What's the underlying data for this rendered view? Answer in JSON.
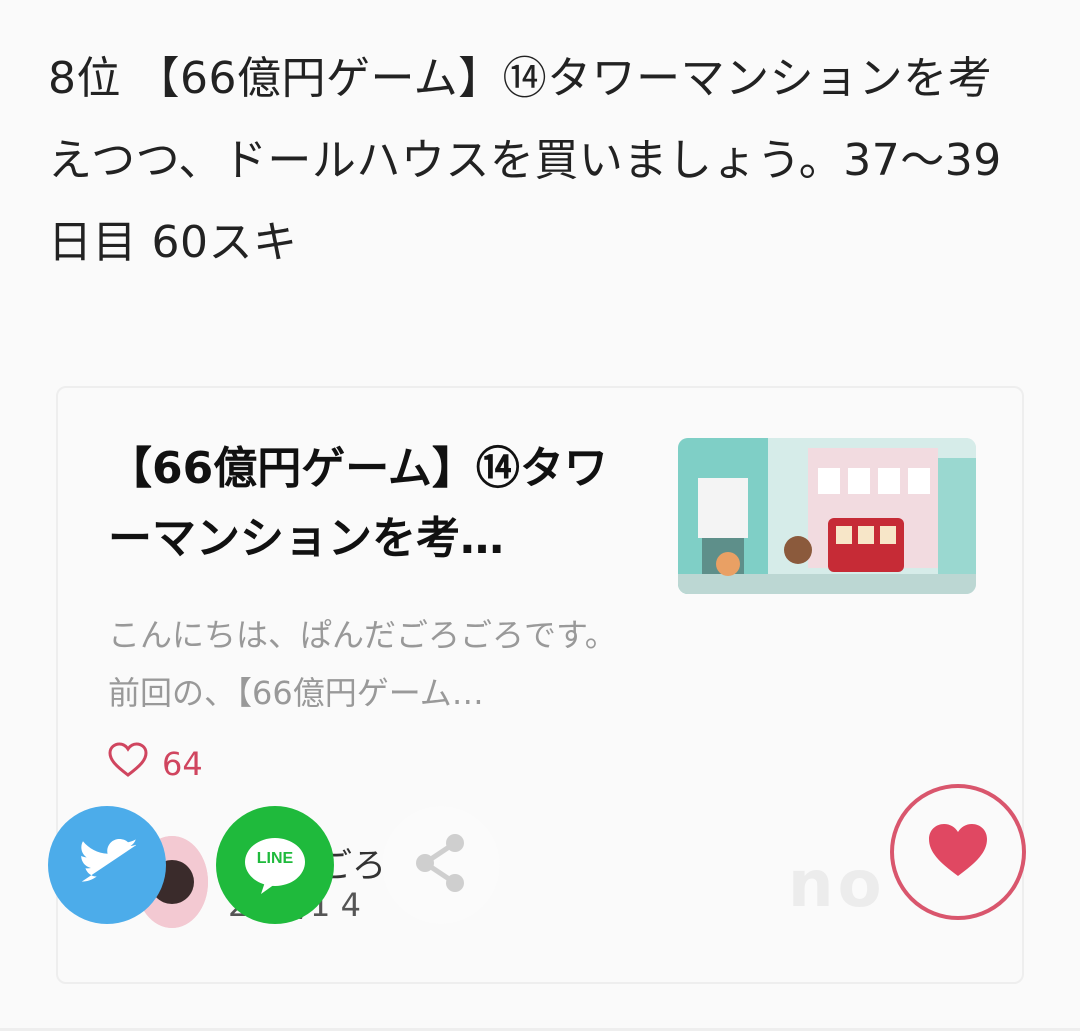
{
  "heading": {
    "text": "8位 【66億円ゲーム】⑭タワーマンションを考えつつ、ドールハウスを買いましょう。37〜39日目 60スキ"
  },
  "card": {
    "title": "【66億円ゲーム】⑭タワーマンションを考…",
    "excerpt": "こんにちは、ぱんだごろごろです。前回の、【66億円ゲーム…",
    "likes_count": "64",
    "author_name": "ごろ",
    "date": "2 12/1 4",
    "watermark": "no"
  },
  "share": {
    "line_label": "LINE"
  },
  "icons": {
    "heart_outline": "heart-outline-icon",
    "twitter": "twitter-bird-icon",
    "share": "share-icon",
    "like": "heart-filled-icon"
  },
  "colors": {
    "twitter": "#4cacea",
    "line": "#1fba3c",
    "like": "#d9566d",
    "text": "#222222",
    "muted": "#999999"
  }
}
